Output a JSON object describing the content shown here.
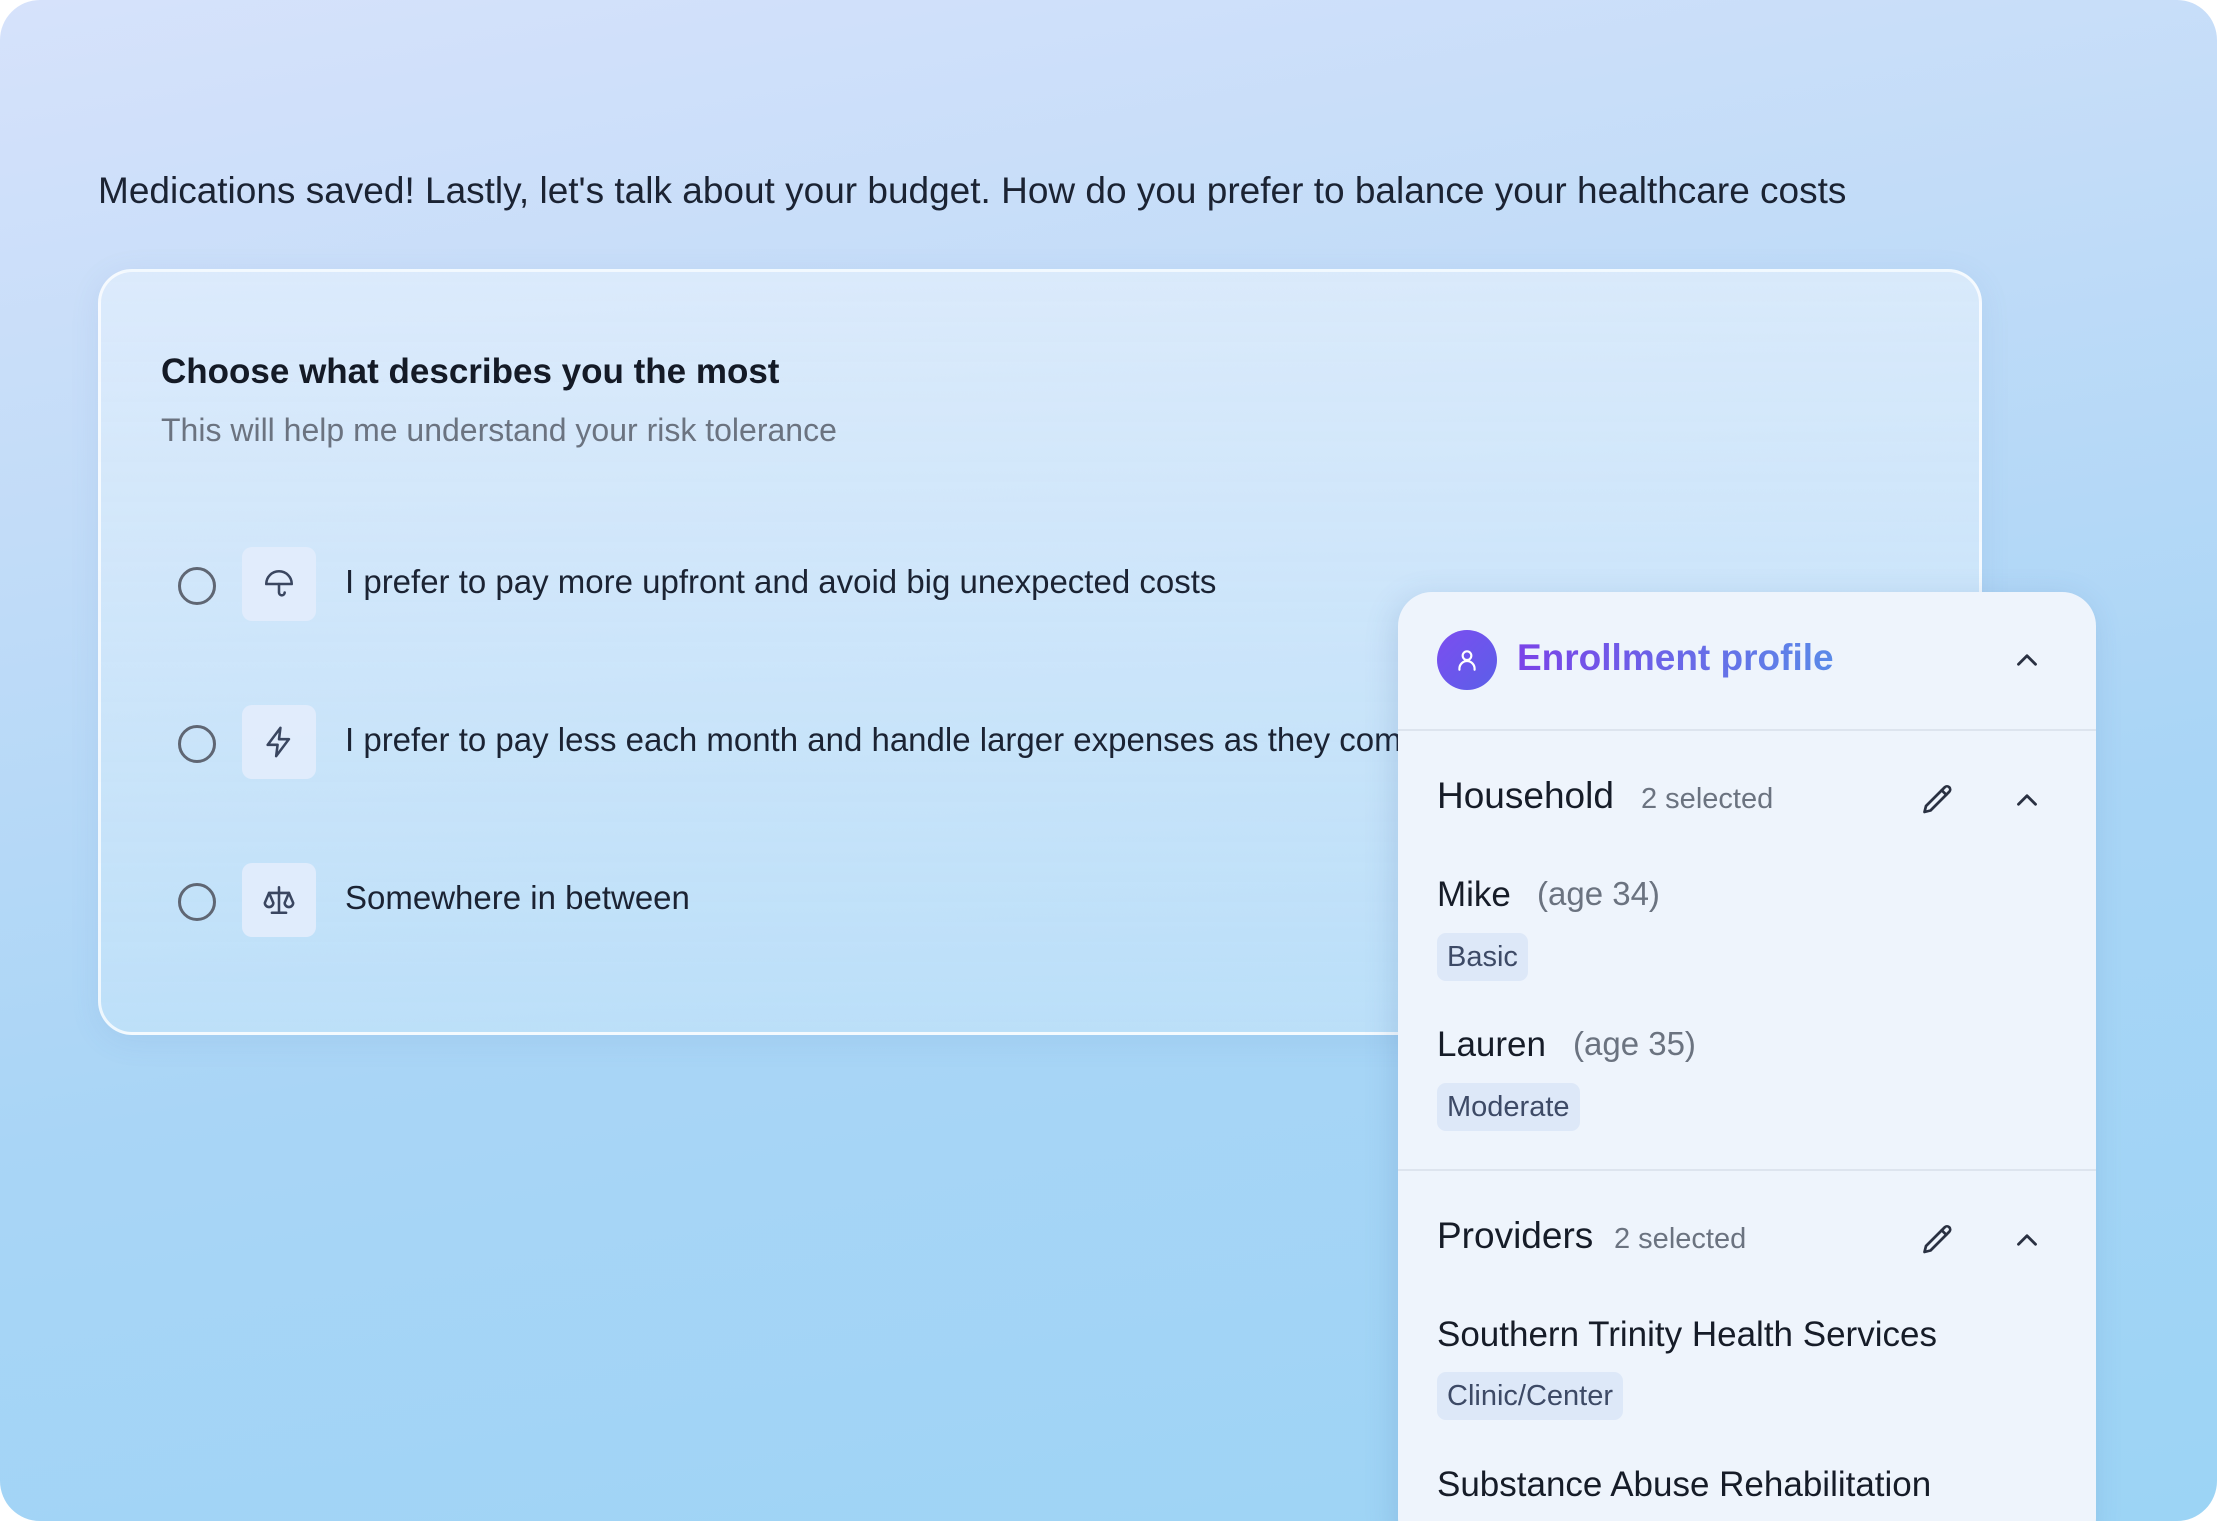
{
  "prompt": "Medications saved! Lastly, let's talk about your budget. How do you prefer to balance your healthcare costs",
  "question": {
    "title": "Choose what describes you the most",
    "subtitle": "This will help me understand your risk tolerance",
    "options": [
      {
        "label": "I prefer to pay more upfront and avoid big unexpected costs",
        "icon": "umbrella-icon"
      },
      {
        "label": "I prefer to pay less each month and handle larger expenses as they come",
        "icon": "lightning-icon"
      },
      {
        "label": "Somewhere in between",
        "icon": "scale-icon"
      }
    ]
  },
  "profile": {
    "title": "Enrollment profile",
    "household": {
      "title": "Household",
      "count": "2 selected",
      "members": [
        {
          "name": "Mike",
          "age": "(age 34)",
          "tag": "Basic"
        },
        {
          "name": "Lauren",
          "age": "(age 35)",
          "tag": "Moderate"
        }
      ]
    },
    "providers": {
      "title": "Providers",
      "count": "2 selected",
      "items": [
        {
          "name": "Southern Trinity Health Services",
          "tag": "Clinic/Center"
        },
        {
          "name": "Substance Abuse Rehabilitation"
        }
      ]
    }
  },
  "colors": {
    "accent_purple": "#7a43e8",
    "accent_blue": "#5a8ae8",
    "tag_bg": "#dde8f8"
  }
}
